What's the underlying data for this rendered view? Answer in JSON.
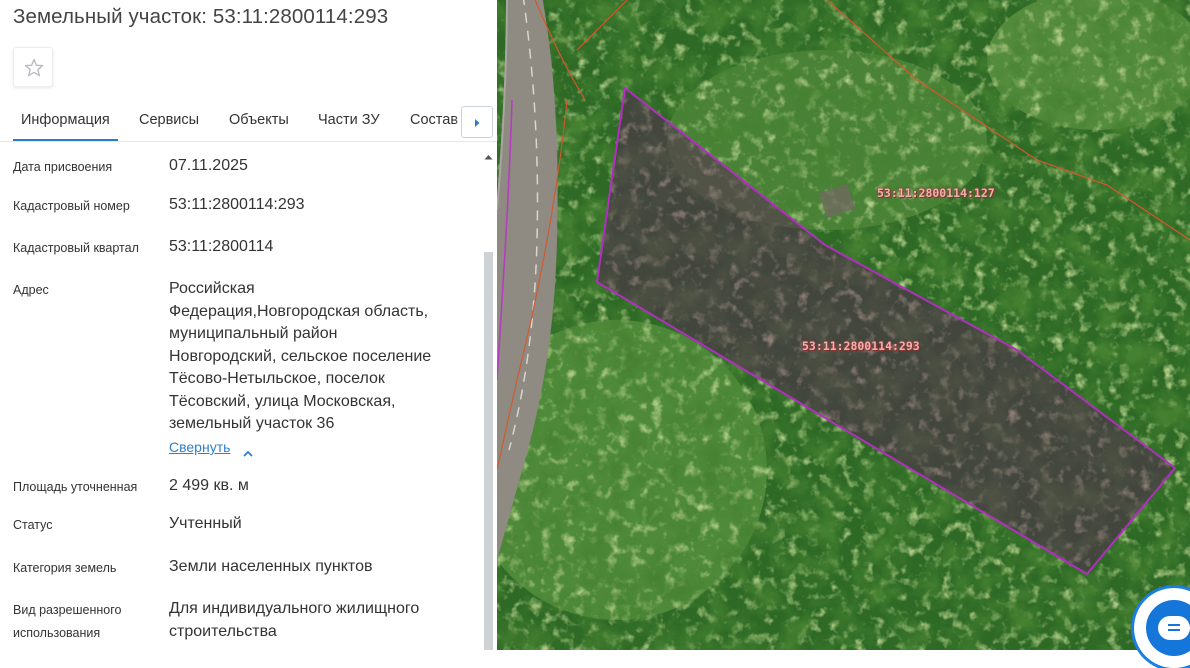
{
  "header": {
    "title": "Земельный участок: 53:11:2800114:293"
  },
  "tabs": [
    "Информация",
    "Сервисы",
    "Объекты",
    "Части ЗУ",
    "Состав"
  ],
  "info": {
    "date": {
      "label": "Дата присвоения",
      "value": "07.11.2025"
    },
    "cadnum": {
      "label": "Кадастровый номер",
      "value": "53:11:2800114:293"
    },
    "quarter": {
      "label": "Кадастровый квартал",
      "value": "53:11:2800114"
    },
    "address": {
      "label": "Адрес",
      "lines": [
        "Российская",
        "Федерация,Новгородская область,",
        "муниципальный район",
        "Новгородский, сельское поселение",
        "Тёсово-Нетыльское, поселок",
        "Тёсовский, улица Московская,",
        "земельный участок 36"
      ],
      "collapse_label": "Свернуть"
    },
    "area": {
      "label": "Площадь уточненная",
      "value": "2 499 кв. м"
    },
    "status": {
      "label": "Статус",
      "value": "Учтенный"
    },
    "category": {
      "label": "Категория земель",
      "value": "Земли населенных пунктов"
    },
    "usage": {
      "label_lines": [
        "Вид разрешенного",
        "использования"
      ],
      "value_lines": [
        "Для индивидуального жилищного",
        "строительства"
      ]
    }
  },
  "map": {
    "main_parcel_label": "53:11:2800114:293",
    "neighbor_parcel_label": "53:11:2800114:127",
    "colors": {
      "parcel_outline": "#b12fbf",
      "parcel_fill": "#5b1a5a",
      "boundary": "#d4582c",
      "accent": "#2a7ccf"
    }
  },
  "icons": {
    "favorite": "star-icon",
    "tabs_next": "caret-right-icon",
    "collapse": "chevron-up-icon",
    "scroll_up": "caret-up-icon",
    "chat": "chat-icon"
  }
}
